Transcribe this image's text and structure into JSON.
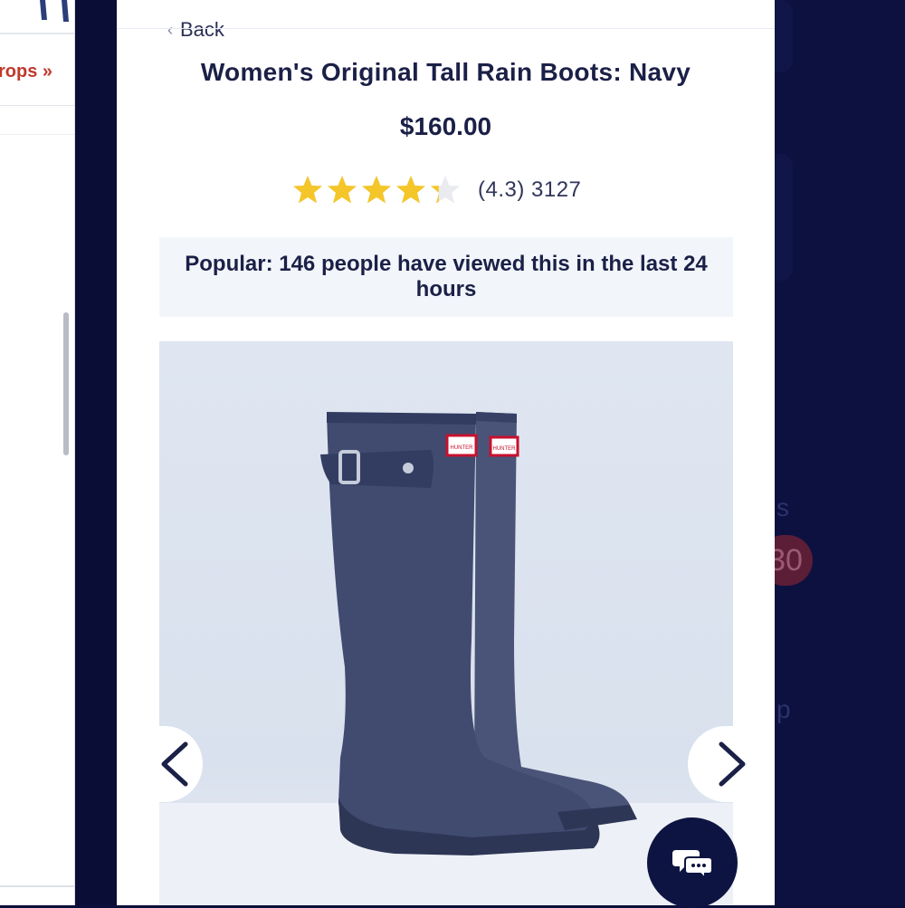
{
  "background_page": {
    "promo_link": "rops »"
  },
  "background_ghost": {
    "badge": "30",
    "letter_s": "s",
    "letter_p": "p"
  },
  "modal": {
    "back_label": "Back",
    "product_title": "Women's Original Tall Rain Boots: Navy",
    "price": "$160.00",
    "rating": {
      "value": 4.3,
      "max": 5,
      "label": "(4.3) 3127",
      "star_color": "#f4c62a"
    },
    "popular_note": "Popular: 146 people have viewed this in the last 24 hours",
    "product_image": {
      "brand_tag": "HUNTER",
      "prev_icon": "chevron-left-icon",
      "next_icon": "chevron-right-icon"
    },
    "chat_icon": "chat-bubbles-icon"
  },
  "colors": {
    "text_primary": "#1b2047",
    "promo_red": "#c0392b",
    "boot_navy": "#3f4a6e",
    "tag_red": "#c8102e"
  }
}
